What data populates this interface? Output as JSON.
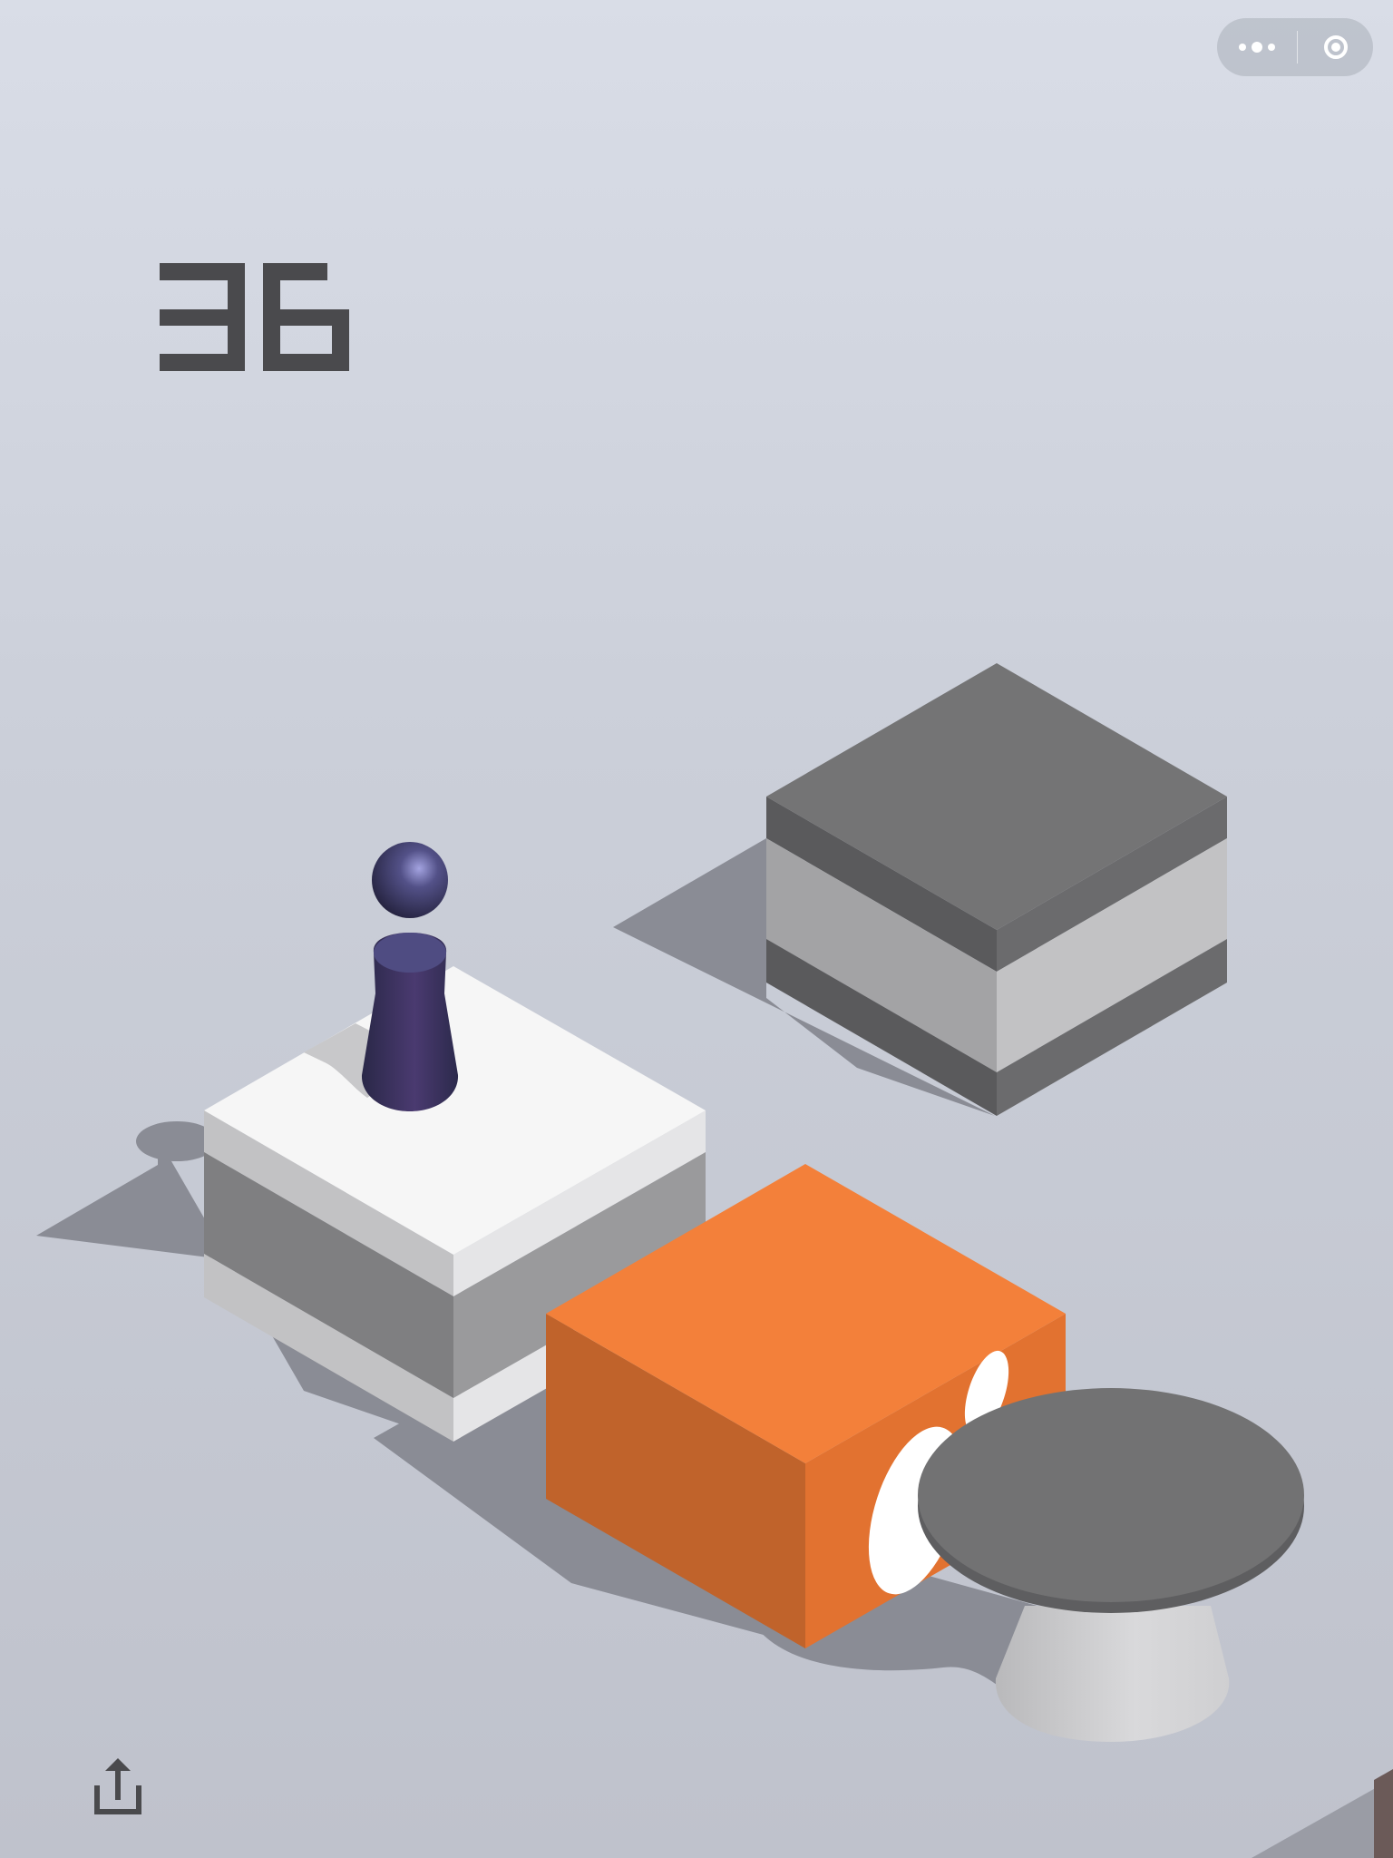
{
  "game": {
    "score": "36"
  },
  "topbar": {
    "more_icon": "more-dots-icon",
    "close_icon": "target-close-icon"
  },
  "bottombar": {
    "share_icon": "share-upload-icon"
  },
  "colors": {
    "background_top": "#d9dde7",
    "background_bottom": "#bfc2cc",
    "score": "#4a4a4d",
    "orange_block": "#f3803a",
    "player": "#3b3a66"
  }
}
